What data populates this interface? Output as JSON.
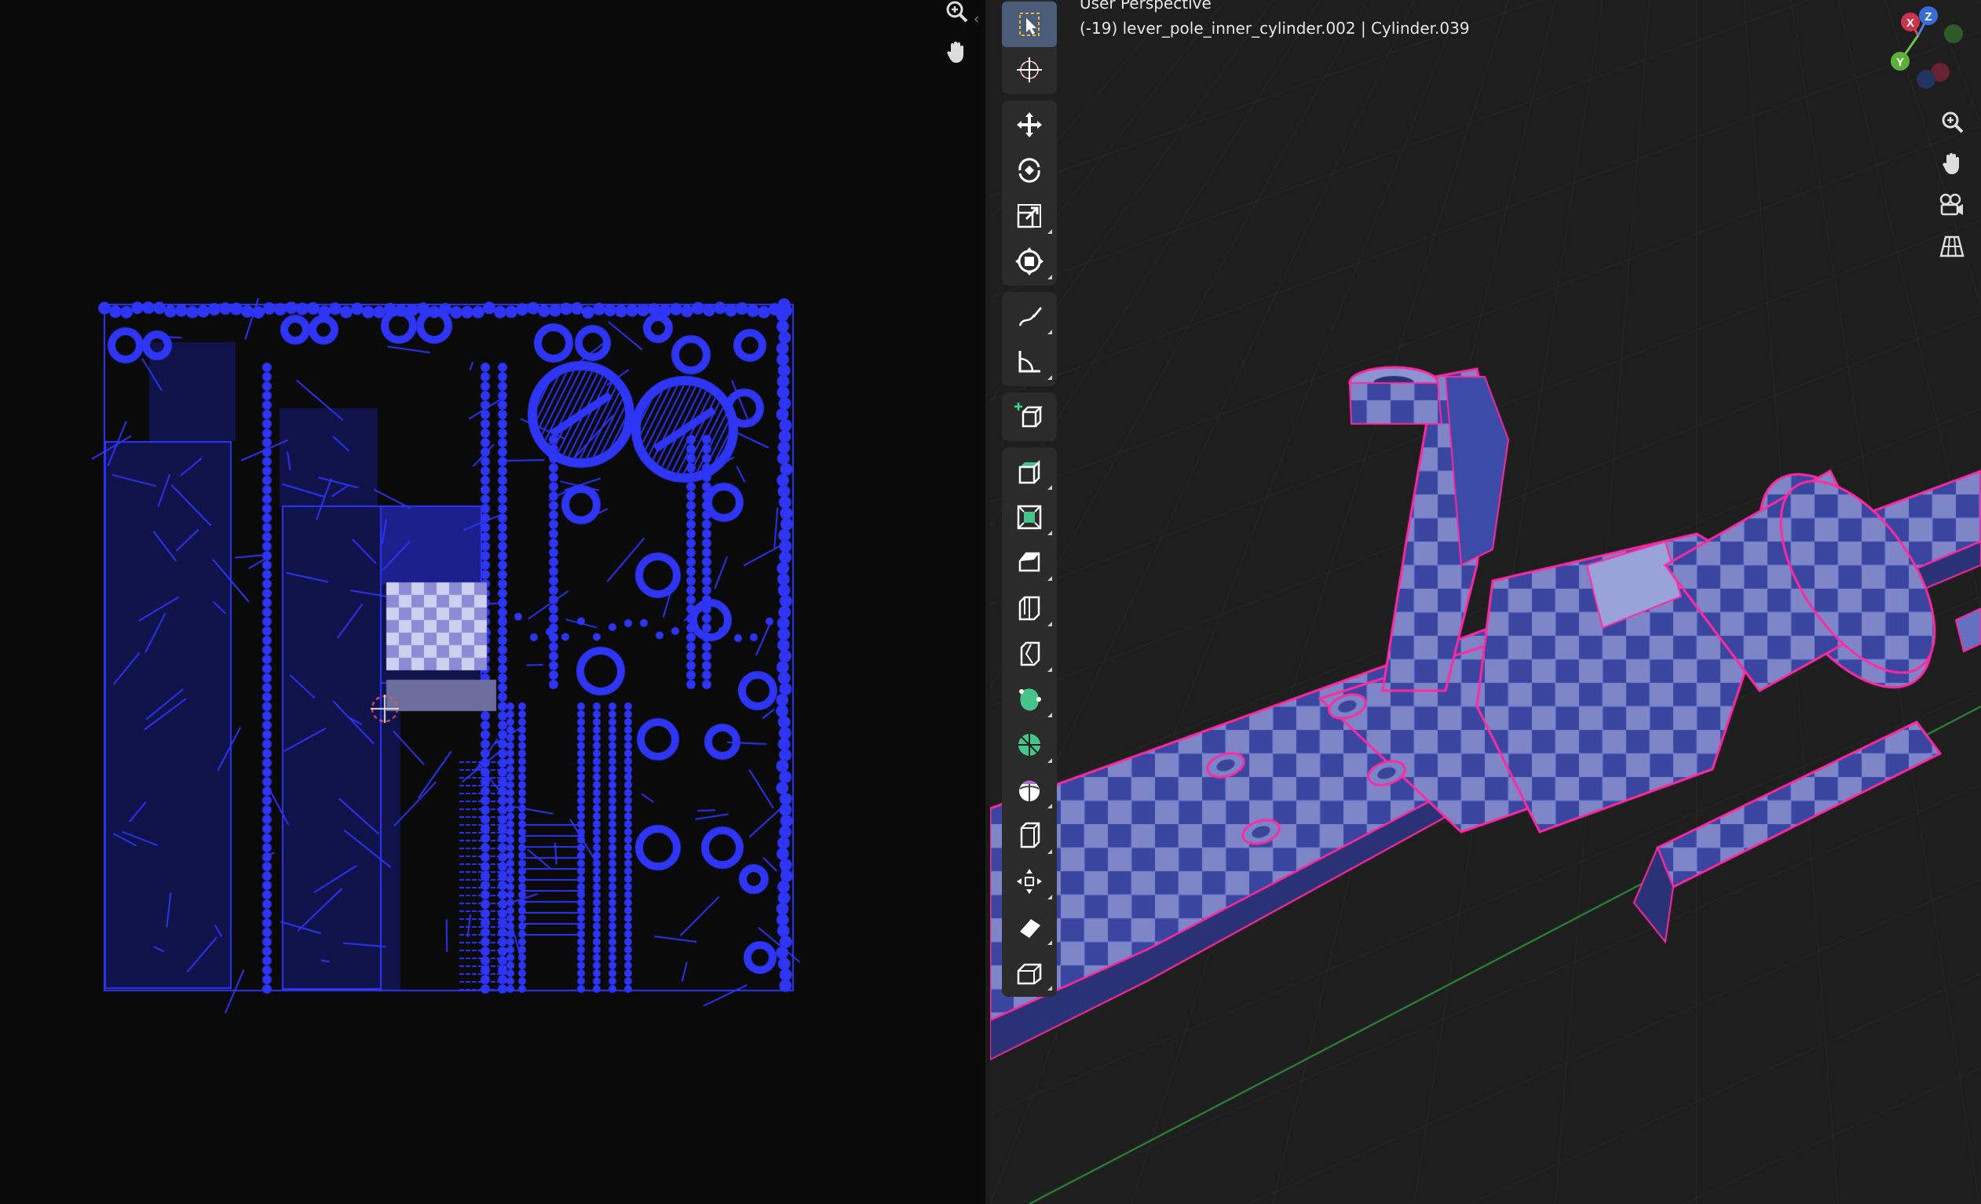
{
  "viewport": {
    "mode_label": "User Perspective",
    "object_info": "(-19) lever_pole_inner_cylinder.002 | Cylinder.039"
  },
  "gizmo": {
    "x_label": "X",
    "y_label": "Y",
    "z_label": "Z"
  },
  "colors": {
    "uv_island": "#2e35f5",
    "uv_background": "#0a0a0a",
    "viewport_bg": "#1e1e1f",
    "selection_edge": "#ff2aa0",
    "toolbar_bg": "#2b2b2b",
    "active_tool": "#4a5c78",
    "grid_line": "#2a2a2a",
    "axis_y_line": "#2e8b3a"
  },
  "toolbar": {
    "tools": [
      {
        "icon": "select-box-icon",
        "label": "Select Box",
        "active": true
      },
      {
        "icon": "cursor-icon",
        "label": "Cursor"
      },
      {
        "icon": "move-icon",
        "label": "Move"
      },
      {
        "icon": "rotate-icon",
        "label": "Rotate"
      },
      {
        "icon": "scale-icon",
        "label": "Scale"
      },
      {
        "icon": "transform-icon",
        "label": "Transform"
      },
      {
        "icon": "annotate-icon",
        "label": "Annotate"
      },
      {
        "icon": "measure-icon",
        "label": "Measure"
      },
      {
        "icon": "add-cube-icon",
        "label": "Add Cube"
      },
      {
        "icon": "extrude-icon",
        "label": "Extrude Region"
      },
      {
        "icon": "inset-icon",
        "label": "Inset Faces"
      },
      {
        "icon": "bevel-icon",
        "label": "Bevel"
      },
      {
        "icon": "loop-cut-icon",
        "label": "Loop Cut"
      },
      {
        "icon": "knife-icon",
        "label": "Knife"
      },
      {
        "icon": "poly-build-icon",
        "label": "Poly Build"
      },
      {
        "icon": "spin-icon",
        "label": "Spin"
      },
      {
        "icon": "smooth-icon",
        "label": "Smooth"
      },
      {
        "icon": "edge-slide-icon",
        "label": "Edge Slide"
      },
      {
        "icon": "shrink-fatten-icon",
        "label": "Shrink/Fatten"
      },
      {
        "icon": "shear-icon",
        "label": "Shear"
      },
      {
        "icon": "rip-region-icon",
        "label": "Rip Region"
      }
    ]
  },
  "uv_nav": [
    "zoom-icon",
    "hand-pan-icon"
  ],
  "viewport_nav": [
    "zoom-icon",
    "hand-pan-icon",
    "camera-icon",
    "grid-view-icon"
  ]
}
